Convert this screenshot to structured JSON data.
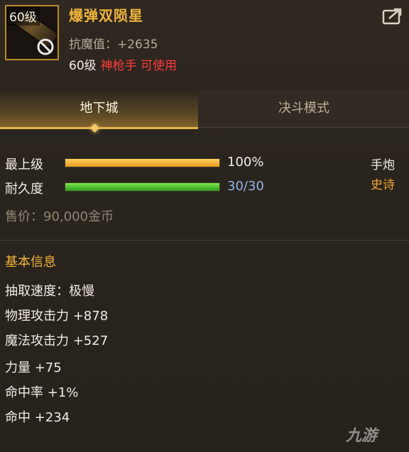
{
  "item": {
    "level_tag": "60级",
    "name": "爆弹双陨星",
    "anti_magic": "抗魔值：+2635",
    "req_level": "60级",
    "req_class": "神枪手 可使用"
  },
  "tabs": {
    "active": "地下城",
    "inactive": "决斗模式"
  },
  "bars": {
    "grade_label": "最上级",
    "grade_value": "100%",
    "grade_fraction": 1.0,
    "durability_label": "耐久度",
    "durability_value": "30/30",
    "durability_fraction": 1.0
  },
  "type_label": "手炮",
  "rarity": "史诗",
  "price": "售价：90,000金币",
  "basic_info": {
    "title": "基本信息",
    "stats": [
      "抽取速度：极慢",
      "物理攻击力 +878",
      "魔法攻击力 +527",
      "力量 +75",
      "命中率 +1%",
      "命中 +234"
    ]
  },
  "watermark": "九游",
  "colors": {
    "name_gold": "#f0b43a",
    "class_red": "#ff3b3b",
    "rarity_orange": "#f0a531",
    "bar_orange": "#e59a1f",
    "bar_green": "#2e9c1c"
  },
  "icons": {
    "share": "share-icon",
    "no_use": "prohibited-icon"
  }
}
